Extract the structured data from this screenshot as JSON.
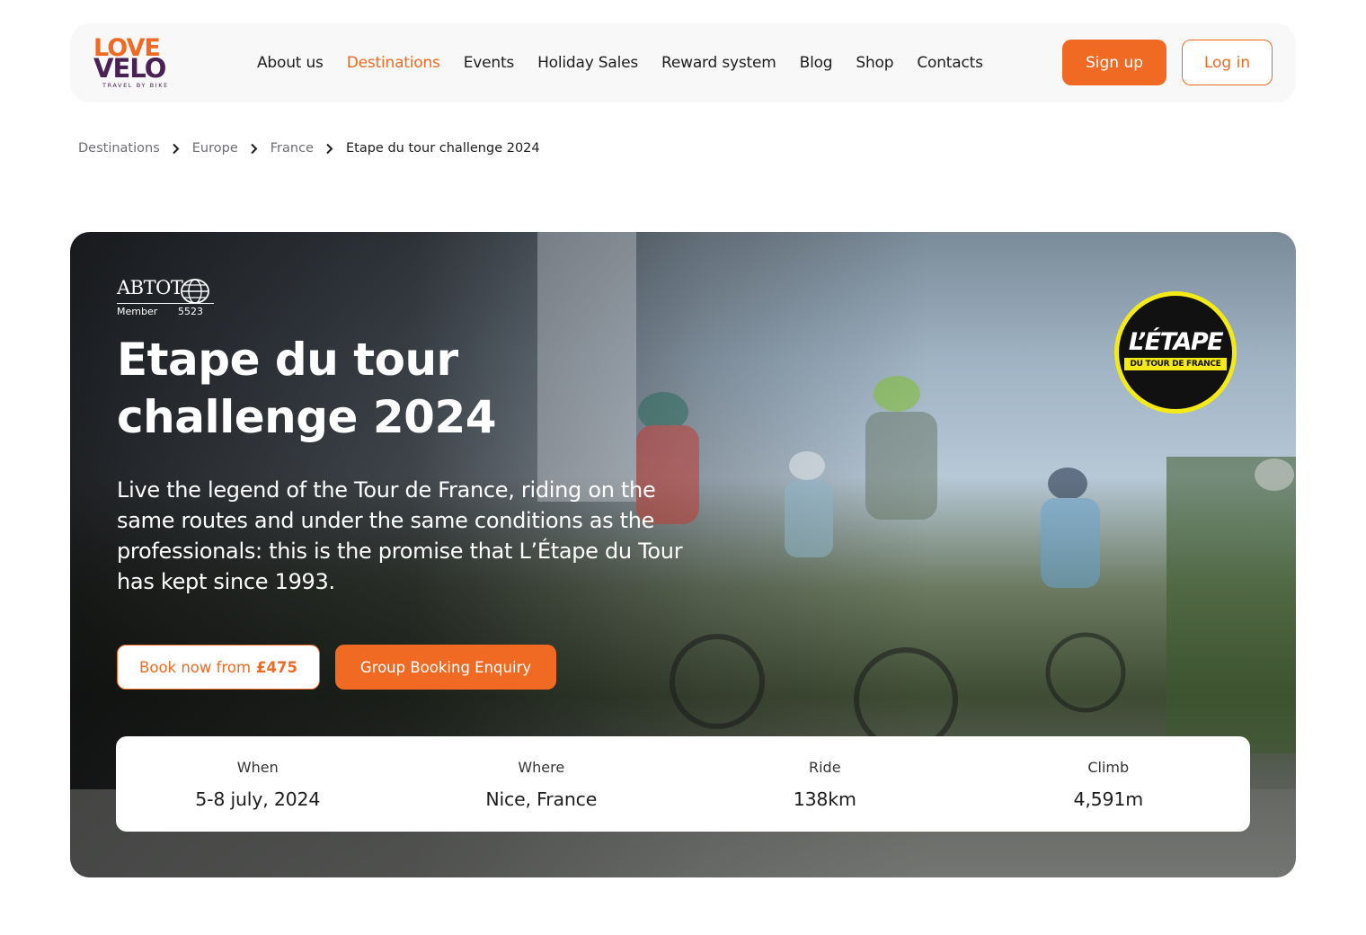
{
  "brand": {
    "logo_top": "LOVE",
    "logo_bottom": "VELO",
    "tagline": "TRAVEL BY BIKE",
    "accent_color": "#f06a24",
    "dark_color": "#4a2155"
  },
  "nav": {
    "items": [
      {
        "label": "About us",
        "active": false
      },
      {
        "label": "Destinations",
        "active": true
      },
      {
        "label": "Events",
        "active": false
      },
      {
        "label": "Holiday Sales",
        "active": false
      },
      {
        "label": "Reward system",
        "active": false
      },
      {
        "label": "Blog",
        "active": false
      },
      {
        "label": "Shop",
        "active": false
      },
      {
        "label": "Contacts",
        "active": false
      }
    ],
    "signup_label": "Sign up",
    "login_label": "Log in"
  },
  "breadcrumb": {
    "items": [
      "Destinations",
      "Europe",
      "France"
    ],
    "current": "Etape du tour challenge 2024",
    "separator_icon": "chevron-right-icon"
  },
  "hero": {
    "abtot": {
      "word": "ABTOT",
      "member": "Member",
      "number": "5523"
    },
    "title_line1": "Etape du tour",
    "title_line2": "challenge 2024",
    "description": "Live the legend of the Tour de France, riding on the same routes and under the same conditions as the professionals: this is the promise that L’Étape du Tour has kept since 1993.",
    "book_prefix": "Book now from",
    "book_price": "£475",
    "group_label": "Group Booking Enquiry",
    "badge": {
      "main": "L’ÉTAPE",
      "sub": "DU TOUR DE FRANCE",
      "ring_color": "#f3ea18"
    }
  },
  "info": [
    {
      "label": "When",
      "value": "5-8 july, 2024"
    },
    {
      "label": "Where",
      "value": "Nice, France"
    },
    {
      "label": "Ride",
      "value": "138km"
    },
    {
      "label": "Climb",
      "value": "4,591m"
    }
  ]
}
